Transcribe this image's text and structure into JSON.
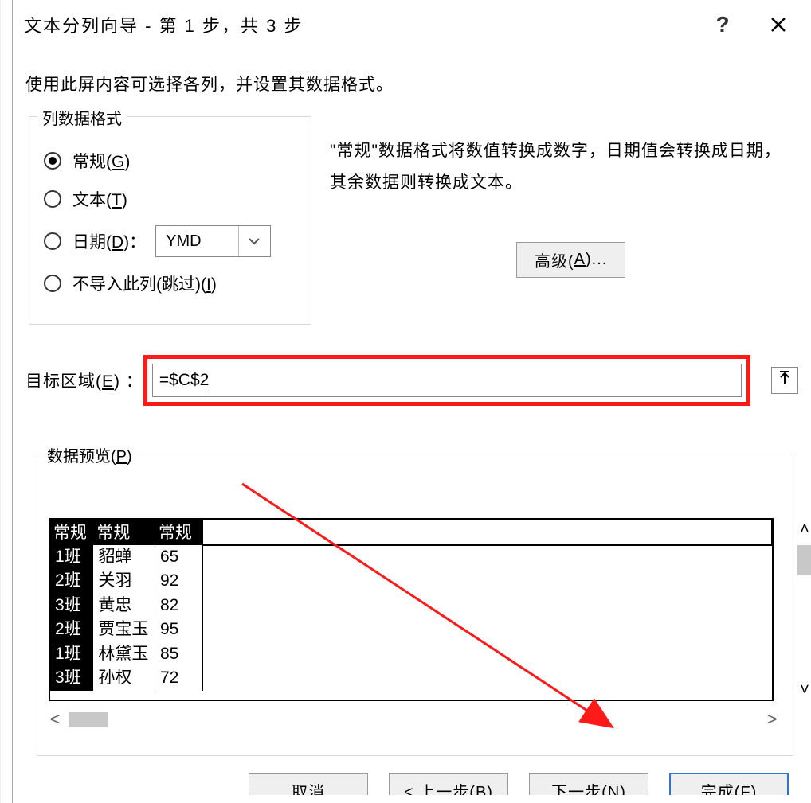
{
  "titlebar": {
    "title": "文本分列向导 - 第 1 步，共 3 步",
    "help": "?",
    "close": "✕"
  },
  "instruction": "使用此屏内容可选择各列，并设置其数据格式。",
  "format_group": {
    "legend": "列数据格式",
    "radios": {
      "general_pre": "常规(",
      "general_key": "G",
      "general_post": ")",
      "text_pre": "文本(",
      "text_key": "T",
      "text_post": ")",
      "date_pre": "日期(",
      "date_key": "D",
      "date_post": ")：",
      "date_value": "YMD",
      "skip_pre": "不导入此列(跳过)(",
      "skip_key": "I",
      "skip_post": ")"
    },
    "description": "\"常规\"数据格式将数值转换成数字，日期值会转换成日期，其余数据则转换成文本。",
    "advanced_pre": "高级(",
    "advanced_key": "A",
    "advanced_post": ")..."
  },
  "destination": {
    "label_pre": "目标区域(",
    "label_key": "E",
    "label_post": "：",
    "value": "=$C$2"
  },
  "preview": {
    "legend_pre": "数据预览(",
    "legend_key": "P",
    "legend_post": ")",
    "headers": [
      "常规",
      "常规",
      "常规"
    ],
    "rows": [
      [
        "1班",
        "貂蝉",
        "65"
      ],
      [
        "2班",
        "关羽",
        "92"
      ],
      [
        "3班",
        "黄忠",
        "82"
      ],
      [
        "2班",
        "贾宝玉",
        "95"
      ],
      [
        "1班",
        "林黛玉",
        "85"
      ],
      [
        "3班",
        "孙权",
        "72"
      ]
    ]
  },
  "buttons": {
    "cancel": "取消",
    "back": "< 上一步(B)",
    "next": "下一步(N)",
    "finish": "完成(F)"
  }
}
